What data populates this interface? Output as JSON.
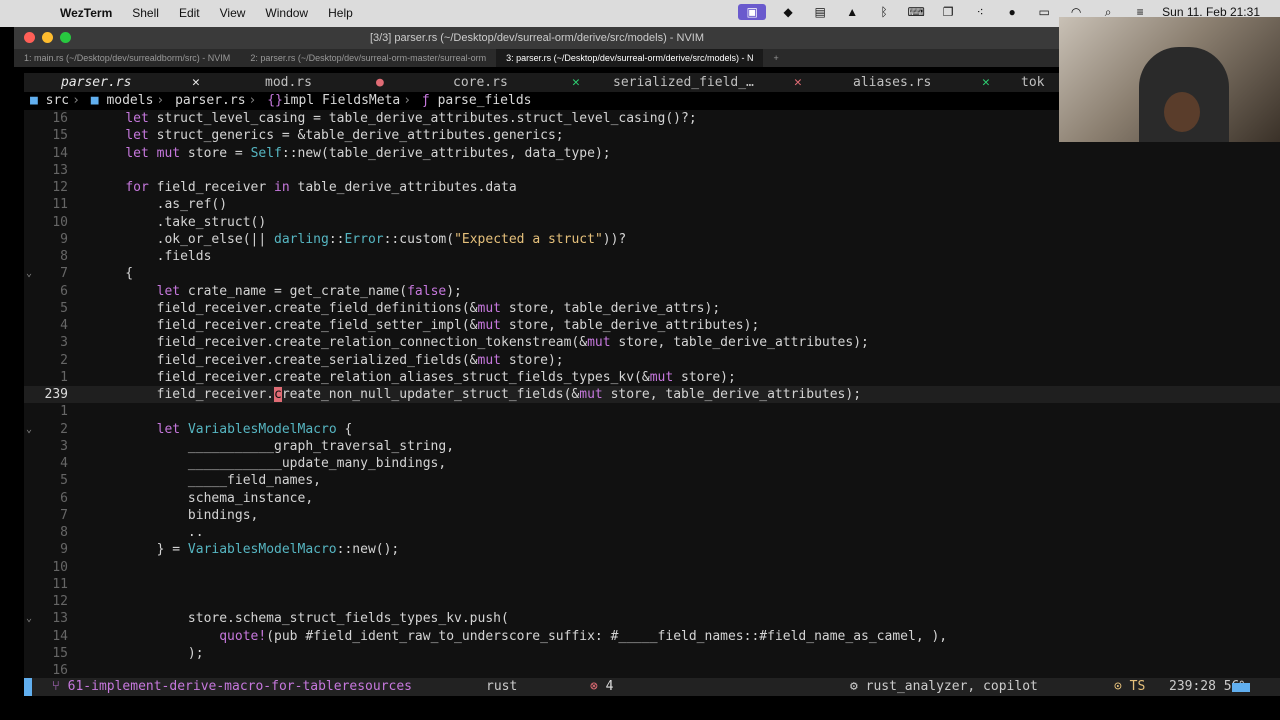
{
  "menubar": {
    "app": "WezTerm",
    "menus": [
      "Shell",
      "Edit",
      "View",
      "Window",
      "Help"
    ],
    "datetime": "Sun 11. Feb 21:31"
  },
  "window": {
    "title": "[3/3] parser.rs (~/Desktop/dev/surreal-orm/derive/src/models) - NVIM"
  },
  "terminal_tabs": [
    "1: main.rs (~/Desktop/dev/surrealdborm/src) - NVIM",
    "2: parser.rs (~/Desktop/dev/surreal-orm-master/surreal-orm",
    "3: parser.rs (~/Desktop/dev/surreal-orm/derive/src/models) - N"
  ],
  "buffers": [
    {
      "name": "parser.rs",
      "active": true,
      "mark": "✕"
    },
    {
      "name": "mod.rs",
      "active": false,
      "mark": "●"
    },
    {
      "name": "core.rs",
      "active": false,
      "mark": "✕"
    },
    {
      "name": "serialized_field_…",
      "active": false,
      "mark": "✕"
    },
    {
      "name": "aliases.rs",
      "active": false,
      "mark": "✕"
    },
    {
      "name": "tok",
      "active": false,
      "mark": ""
    }
  ],
  "breadcrumb": {
    "dir1": "src",
    "dir2": "models",
    "file": "parser.rs",
    "impl": "impl FieldsMeta",
    "fn": "parse_fields"
  },
  "lines": [
    {
      "n": "16",
      "code": "    let struct_level_casing = table_derive_attributes.struct_level_casing()?;"
    },
    {
      "n": "15",
      "code": "    let struct_generics = &table_derive_attributes.generics;"
    },
    {
      "n": "14",
      "code": "    let mut store = Self::new(table_derive_attributes, data_type);"
    },
    {
      "n": "13",
      "code": ""
    },
    {
      "n": "12",
      "code": "    for field_receiver in table_derive_attributes.data"
    },
    {
      "n": "11",
      "code": "        .as_ref()"
    },
    {
      "n": "10",
      "code": "        .take_struct()"
    },
    {
      "n": "9",
      "code": "        .ok_or_else(|| darling::Error::custom(\"Expected a struct\"))?"
    },
    {
      "n": "8",
      "code": "        .fields"
    },
    {
      "n": "7",
      "code": "    {",
      "fold": true
    },
    {
      "n": "6",
      "code": "        let crate_name = get_crate_name(false);"
    },
    {
      "n": "5",
      "code": "        field_receiver.create_field_definitions(&mut store, table_derive_attrs);"
    },
    {
      "n": "4",
      "code": "        field_receiver.create_field_setter_impl(&mut store, table_derive_attributes);"
    },
    {
      "n": "3",
      "code": "        field_receiver.create_relation_connection_tokenstream(&mut store, table_derive_attributes);"
    },
    {
      "n": "2",
      "code": "        field_receiver.create_serialized_fields(&mut store);"
    },
    {
      "n": "1",
      "code": "        field_receiver.create_relation_aliases_struct_fields_types_kv(&mut store);"
    },
    {
      "n": "239",
      "code": "        field_receiver.create_non_null_updater_struct_fields(&mut store, table_derive_attributes);",
      "current": true
    },
    {
      "n": "1",
      "code": ""
    },
    {
      "n": "2",
      "code": "        let VariablesModelMacro {",
      "fold": true
    },
    {
      "n": "3",
      "code": "            ___________graph_traversal_string,"
    },
    {
      "n": "4",
      "code": "            ____________update_many_bindings,"
    },
    {
      "n": "5",
      "code": "            _____field_names,"
    },
    {
      "n": "6",
      "code": "            schema_instance,"
    },
    {
      "n": "7",
      "code": "            bindings,"
    },
    {
      "n": "8",
      "code": "            .."
    },
    {
      "n": "9",
      "code": "        } = VariablesModelMacro::new();"
    },
    {
      "n": "10",
      "code": ""
    },
    {
      "n": "11",
      "code": ""
    },
    {
      "n": "12",
      "code": ""
    },
    {
      "n": "13",
      "code": "            store.schema_struct_fields_types_kv.push(",
      "fold": true
    },
    {
      "n": "14",
      "code": "                quote!(pub #field_ident_raw_to_underscore_suffix: #_____field_names::#field_name_as_camel, ),"
    },
    {
      "n": "15",
      "code": "            );"
    },
    {
      "n": "16",
      "code": ""
    }
  ],
  "statusline": {
    "branch": "61-implement-derive-macro-for-tableresources",
    "language": "rust",
    "errors": "4",
    "lsp": "rust_analyzer, copilot",
    "ts": "TS",
    "position": "239:28",
    "percent": "56%"
  },
  "colors": {
    "accent": "#61afef",
    "keyword": "#c678dd",
    "string": "#e5c07b",
    "error": "#e06c75"
  }
}
